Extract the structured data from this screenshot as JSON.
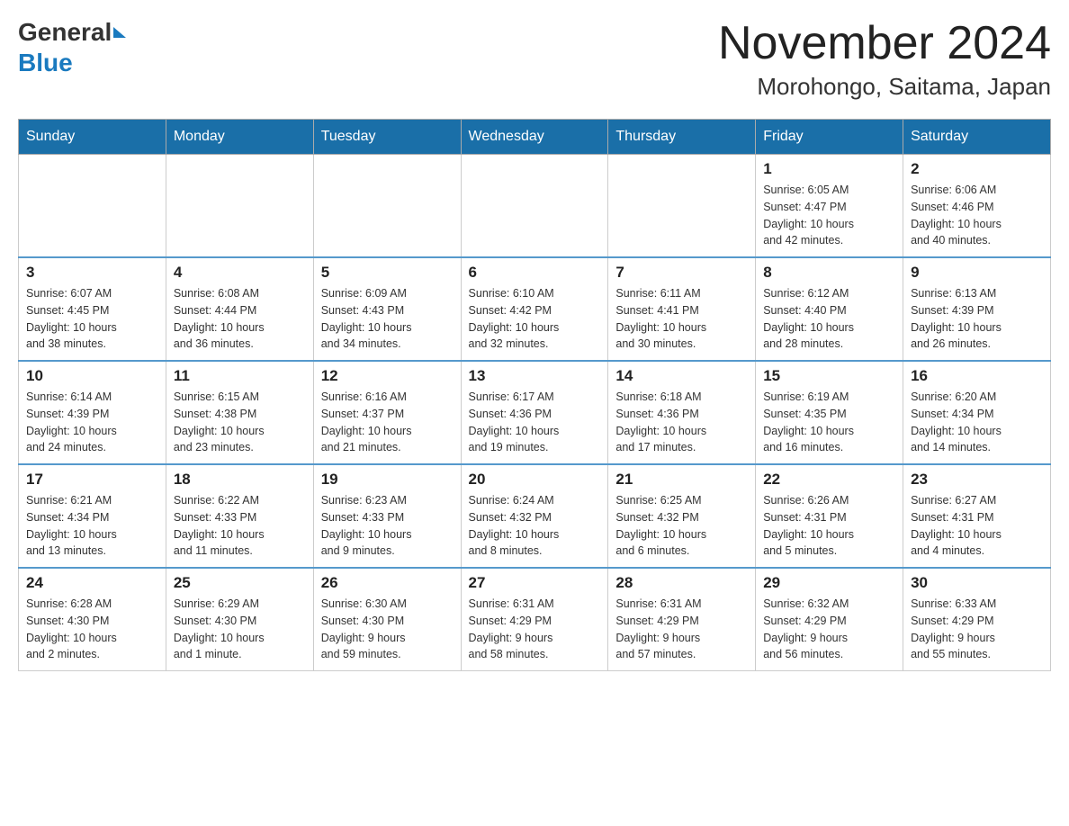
{
  "header": {
    "logo": {
      "general_text": "General",
      "blue_text": "Blue"
    },
    "title": "November 2024",
    "location": "Morohongo, Saitama, Japan"
  },
  "calendar": {
    "days_of_week": [
      "Sunday",
      "Monday",
      "Tuesday",
      "Wednesday",
      "Thursday",
      "Friday",
      "Saturday"
    ],
    "weeks": [
      {
        "days": [
          {
            "number": "",
            "info": ""
          },
          {
            "number": "",
            "info": ""
          },
          {
            "number": "",
            "info": ""
          },
          {
            "number": "",
            "info": ""
          },
          {
            "number": "",
            "info": ""
          },
          {
            "number": "1",
            "info": "Sunrise: 6:05 AM\nSunset: 4:47 PM\nDaylight: 10 hours\nand 42 minutes."
          },
          {
            "number": "2",
            "info": "Sunrise: 6:06 AM\nSunset: 4:46 PM\nDaylight: 10 hours\nand 40 minutes."
          }
        ]
      },
      {
        "days": [
          {
            "number": "3",
            "info": "Sunrise: 6:07 AM\nSunset: 4:45 PM\nDaylight: 10 hours\nand 38 minutes."
          },
          {
            "number": "4",
            "info": "Sunrise: 6:08 AM\nSunset: 4:44 PM\nDaylight: 10 hours\nand 36 minutes."
          },
          {
            "number": "5",
            "info": "Sunrise: 6:09 AM\nSunset: 4:43 PM\nDaylight: 10 hours\nand 34 minutes."
          },
          {
            "number": "6",
            "info": "Sunrise: 6:10 AM\nSunset: 4:42 PM\nDaylight: 10 hours\nand 32 minutes."
          },
          {
            "number": "7",
            "info": "Sunrise: 6:11 AM\nSunset: 4:41 PM\nDaylight: 10 hours\nand 30 minutes."
          },
          {
            "number": "8",
            "info": "Sunrise: 6:12 AM\nSunset: 4:40 PM\nDaylight: 10 hours\nand 28 minutes."
          },
          {
            "number": "9",
            "info": "Sunrise: 6:13 AM\nSunset: 4:39 PM\nDaylight: 10 hours\nand 26 minutes."
          }
        ]
      },
      {
        "days": [
          {
            "number": "10",
            "info": "Sunrise: 6:14 AM\nSunset: 4:39 PM\nDaylight: 10 hours\nand 24 minutes."
          },
          {
            "number": "11",
            "info": "Sunrise: 6:15 AM\nSunset: 4:38 PM\nDaylight: 10 hours\nand 23 minutes."
          },
          {
            "number": "12",
            "info": "Sunrise: 6:16 AM\nSunset: 4:37 PM\nDaylight: 10 hours\nand 21 minutes."
          },
          {
            "number": "13",
            "info": "Sunrise: 6:17 AM\nSunset: 4:36 PM\nDaylight: 10 hours\nand 19 minutes."
          },
          {
            "number": "14",
            "info": "Sunrise: 6:18 AM\nSunset: 4:36 PM\nDaylight: 10 hours\nand 17 minutes."
          },
          {
            "number": "15",
            "info": "Sunrise: 6:19 AM\nSunset: 4:35 PM\nDaylight: 10 hours\nand 16 minutes."
          },
          {
            "number": "16",
            "info": "Sunrise: 6:20 AM\nSunset: 4:34 PM\nDaylight: 10 hours\nand 14 minutes."
          }
        ]
      },
      {
        "days": [
          {
            "number": "17",
            "info": "Sunrise: 6:21 AM\nSunset: 4:34 PM\nDaylight: 10 hours\nand 13 minutes."
          },
          {
            "number": "18",
            "info": "Sunrise: 6:22 AM\nSunset: 4:33 PM\nDaylight: 10 hours\nand 11 minutes."
          },
          {
            "number": "19",
            "info": "Sunrise: 6:23 AM\nSunset: 4:33 PM\nDaylight: 10 hours\nand 9 minutes."
          },
          {
            "number": "20",
            "info": "Sunrise: 6:24 AM\nSunset: 4:32 PM\nDaylight: 10 hours\nand 8 minutes."
          },
          {
            "number": "21",
            "info": "Sunrise: 6:25 AM\nSunset: 4:32 PM\nDaylight: 10 hours\nand 6 minutes."
          },
          {
            "number": "22",
            "info": "Sunrise: 6:26 AM\nSunset: 4:31 PM\nDaylight: 10 hours\nand 5 minutes."
          },
          {
            "number": "23",
            "info": "Sunrise: 6:27 AM\nSunset: 4:31 PM\nDaylight: 10 hours\nand 4 minutes."
          }
        ]
      },
      {
        "days": [
          {
            "number": "24",
            "info": "Sunrise: 6:28 AM\nSunset: 4:30 PM\nDaylight: 10 hours\nand 2 minutes."
          },
          {
            "number": "25",
            "info": "Sunrise: 6:29 AM\nSunset: 4:30 PM\nDaylight: 10 hours\nand 1 minute."
          },
          {
            "number": "26",
            "info": "Sunrise: 6:30 AM\nSunset: 4:30 PM\nDaylight: 9 hours\nand 59 minutes."
          },
          {
            "number": "27",
            "info": "Sunrise: 6:31 AM\nSunset: 4:29 PM\nDaylight: 9 hours\nand 58 minutes."
          },
          {
            "number": "28",
            "info": "Sunrise: 6:31 AM\nSunset: 4:29 PM\nDaylight: 9 hours\nand 57 minutes."
          },
          {
            "number": "29",
            "info": "Sunrise: 6:32 AM\nSunset: 4:29 PM\nDaylight: 9 hours\nand 56 minutes."
          },
          {
            "number": "30",
            "info": "Sunrise: 6:33 AM\nSunset: 4:29 PM\nDaylight: 9 hours\nand 55 minutes."
          }
        ]
      }
    ]
  }
}
